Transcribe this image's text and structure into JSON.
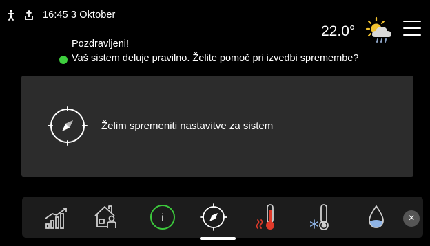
{
  "status_bar": {
    "icons": [
      "person-icon",
      "upload-icon"
    ],
    "datetime": "16:45 3 Oktober"
  },
  "weather": {
    "temperature": "22.0°",
    "icon": "partly-cloudy-rain-icon"
  },
  "messages": {
    "greeting": "Pozdravljeni!",
    "status": "Vaš sistem deluje pravilno. Želite pomoč pri izvedbi spremembe?",
    "status_color": "#3ecf3e"
  },
  "card": {
    "label": "Želim spremeniti nastavitve za sistem",
    "icon": "compass-icon"
  },
  "bottom_nav": {
    "items": [
      {
        "name": "chart-icon"
      },
      {
        "name": "house-person-icon"
      },
      {
        "name": "info-icon",
        "text": "i"
      },
      {
        "name": "compass-icon",
        "active": true
      },
      {
        "name": "heating-thermometer-icon"
      },
      {
        "name": "cooling-thermometer-icon"
      },
      {
        "name": "water-drop-icon"
      }
    ],
    "close_icon": "close-icon",
    "close_label": "×"
  },
  "colors": {
    "background": "#000000",
    "card": "#2c2c2c",
    "bottom_bar": "#1c1c1c",
    "info_green": "#3cc83c",
    "heat_red": "#e03a2a",
    "status_green": "#3ecf3e"
  }
}
